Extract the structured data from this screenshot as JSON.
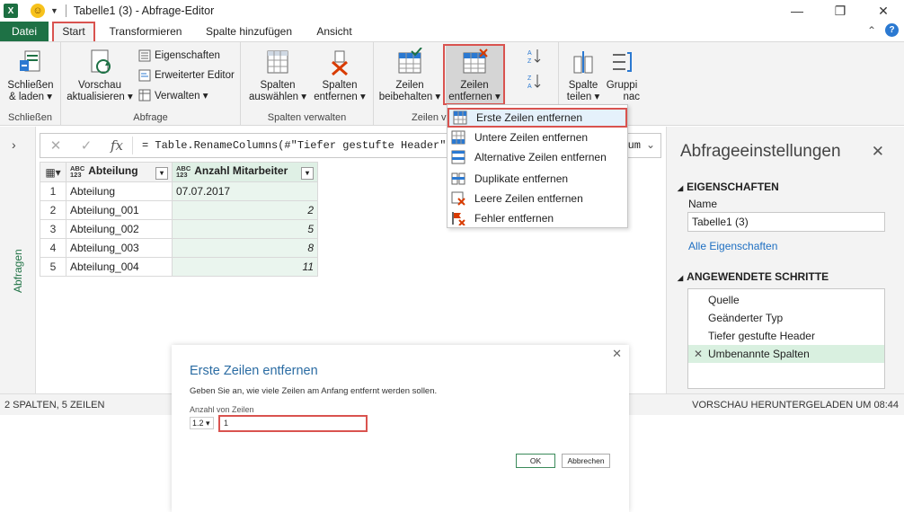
{
  "titlebar": {
    "title": "Tabelle1 (3) - Abfrage-Editor",
    "app_icon": "excel-icon",
    "minimize": "—",
    "restore": "❐",
    "close": "✕"
  },
  "tabs": {
    "datei": "Datei",
    "start": "Start",
    "transformieren": "Transformieren",
    "spalte_hinzufuegen": "Spalte hinzufügen",
    "ansicht": "Ansicht",
    "collapse": "⌃",
    "help": "?"
  },
  "ribbon": {
    "schliessen": {
      "label1": "Schließen",
      "label2": "& laden ▾",
      "group": "Schließen"
    },
    "vorschau": {
      "label1": "Vorschau",
      "label2": "aktualisieren ▾"
    },
    "eigenschaften": "Eigenschaften",
    "erweiterter_editor": "Erweiterter Editor",
    "verwalten": "Verwalten ▾",
    "abfrage_group": "Abfrage",
    "spalten_auswaehlen": {
      "label1": "Spalten",
      "label2": "auswählen ▾"
    },
    "spalten_entfernen": {
      "label1": "Spalten",
      "label2": "entfernen ▾"
    },
    "spalten_group": "Spalten verwalten",
    "zeilen_beibehalten": {
      "label1": "Zeilen",
      "label2": "beibehalten ▾"
    },
    "zeilen_entfernen": {
      "label1": "Zeilen",
      "label2": "entfernen ▾"
    },
    "zeilen_group": "Zeilen ver",
    "spalte_teilen": {
      "label1": "Spalte",
      "label2": "teilen ▾"
    },
    "gruppieren": {
      "label1": "Gruppi",
      "label2": "nac"
    }
  },
  "formula": {
    "text": "= Table.RenameColumns(#\"Tiefer gestufte Header\",{{",
    "tail": "um",
    "cancel": "✕",
    "confirm": "✓",
    "fx": "fx"
  },
  "sidebar": {
    "label": "Abfragen",
    "chevron": "›"
  },
  "grid": {
    "type_badge": "ABC\n123",
    "columns": [
      "Abteilung",
      "Anzahl Mitarbeiter"
    ],
    "rows": [
      {
        "n": "1",
        "a": "Abteilung",
        "b": "07.07.2017"
      },
      {
        "n": "2",
        "a": "Abteilung_001",
        "b": "2"
      },
      {
        "n": "3",
        "a": "Abteilung_002",
        "b": "5"
      },
      {
        "n": "4",
        "a": "Abteilung_003",
        "b": "8"
      },
      {
        "n": "5",
        "a": "Abteilung_004",
        "b": "11"
      }
    ]
  },
  "menu": {
    "items": [
      "Erste Zeilen entfernen",
      "Untere Zeilen entfernen",
      "Alternative Zeilen entfernen",
      "Duplikate entfernen",
      "Leere Zeilen entfernen",
      "Fehler entfernen"
    ]
  },
  "settings": {
    "title": "Abfrageeinstellungen",
    "close": "✕",
    "eigenschaften": "EIGENSCHAFTEN",
    "name_label": "Name",
    "name_value": "Tabelle1 (3)",
    "alle_eigenschaften": "Alle Eigenschaften",
    "schritte": "ANGEWENDETE SCHRITTE",
    "steps": [
      "Quelle",
      "Geänderter Typ",
      "Tiefer gestufte Header",
      "Umbenannte Spalten"
    ]
  },
  "status": {
    "left": "2 SPALTEN, 5 ZEILEN",
    "right": "VORSCHAU HERUNTERGELADEN UM 08:44"
  },
  "dialog": {
    "title": "Erste Zeilen entfernen",
    "description": "Geben Sie an, wie viele Zeilen am Anfang entfernt werden sollen.",
    "field_label": "Anzahl von Zeilen",
    "type_selector": "1.2 ▾",
    "input_value": "1",
    "ok": "OK",
    "cancel": "Abbrechen",
    "close": "✕"
  },
  "colors": {
    "excel_green": "#1e7145",
    "highlight_red": "#d9534f",
    "link_blue": "#1e6fc2"
  }
}
